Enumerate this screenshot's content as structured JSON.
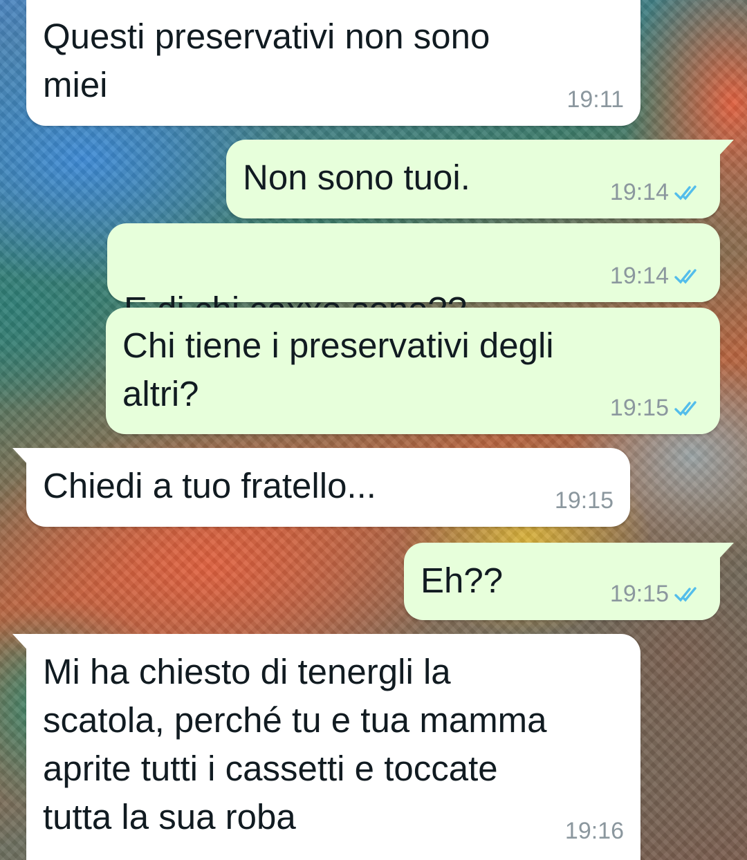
{
  "messages": [
    {
      "id": "m1",
      "direction": "incoming",
      "text": "Questi preservativi non sono\nmiei",
      "time": "19:11"
    },
    {
      "id": "m2",
      "direction": "outgoing",
      "text": "Non sono tuoi.",
      "time": "19:14",
      "status": "read"
    },
    {
      "id": "m3",
      "direction": "outgoing",
      "text_before": "E di chi ",
      "text_redacted": "caxxo",
      "text_after": " sono??",
      "time": "19:14",
      "status": "read"
    },
    {
      "id": "m4",
      "direction": "outgoing",
      "text": "Chi tiene i preservativi degli\naltri?",
      "time": "19:15",
      "status": "read"
    },
    {
      "id": "m5",
      "direction": "incoming",
      "text": "Chiedi a tuo fratello...",
      "time": "19:15"
    },
    {
      "id": "m6",
      "direction": "outgoing",
      "text": "Eh??",
      "time": "19:15",
      "status": "read"
    },
    {
      "id": "m7",
      "direction": "incoming",
      "text": "Mi ha chiesto di tenergli la\nscatola, perché tu e tua mamma\naprite tutti i cassetti e toccate\ntutta la sua roba",
      "time": "19:16"
    }
  ],
  "icons": {
    "read_receipt": "double-check-icon"
  },
  "colors": {
    "incoming_bubble": "#ffffff",
    "outgoing_bubble": "#e7ffdb",
    "read_tick": "#53bdeb",
    "scribble": "#1a74c9"
  }
}
